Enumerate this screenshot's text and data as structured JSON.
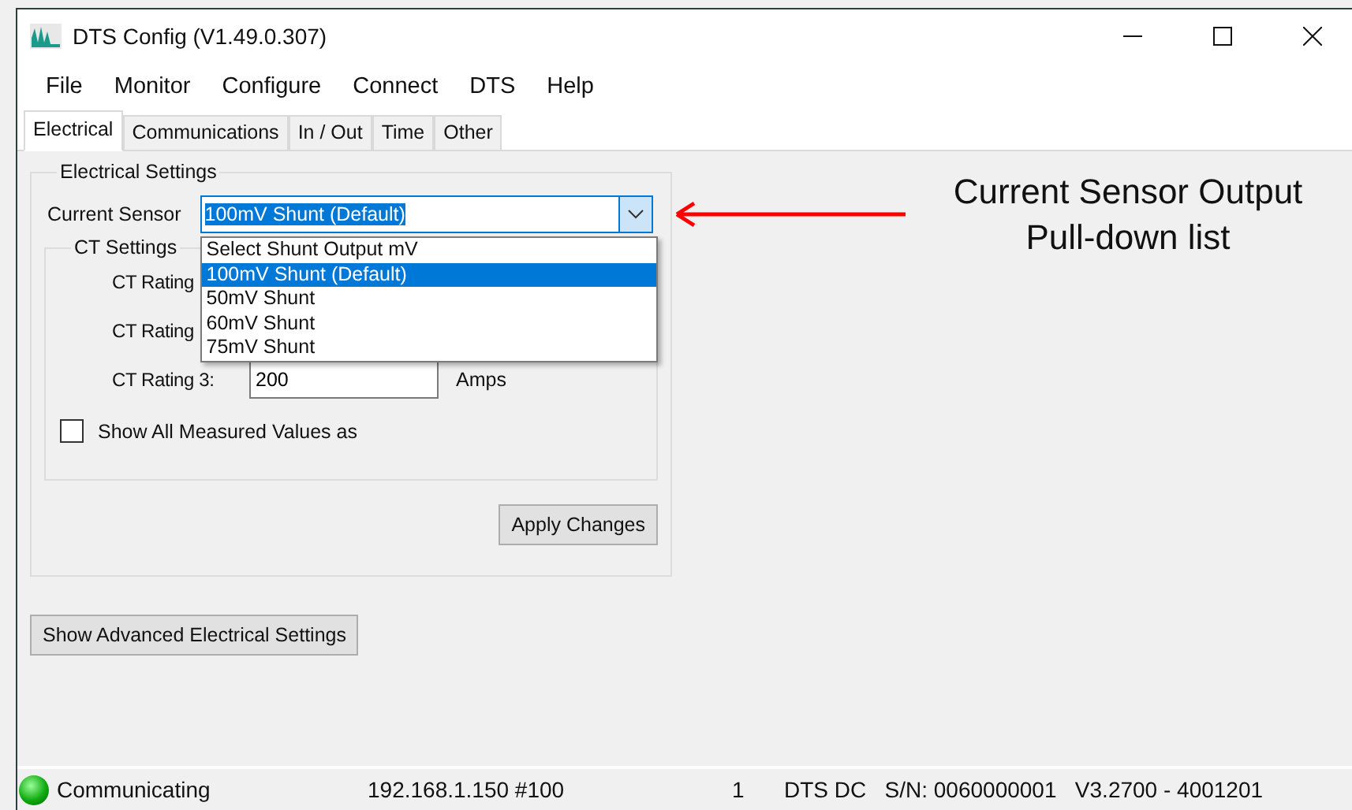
{
  "window": {
    "title": "DTS Config (V1.49.0.307)"
  },
  "menu": [
    "File",
    "Monitor",
    "Configure",
    "Connect",
    "DTS",
    "Help"
  ],
  "tabs": [
    {
      "label": "Electrical",
      "selected": true
    },
    {
      "label": "Communications",
      "selected": false
    },
    {
      "label": "In / Out",
      "selected": false
    },
    {
      "label": "Time",
      "selected": false
    },
    {
      "label": "Other",
      "selected": false
    }
  ],
  "electrical_settings": {
    "title": "Electrical Settings",
    "current_sensor": {
      "label": "Current Sensor",
      "value": "100mV Shunt (Default)",
      "expanded": true,
      "options": [
        {
          "label": "Select Shunt Output mV",
          "selected": false
        },
        {
          "label": "100mV Shunt (Default)",
          "selected": true
        },
        {
          "label": "50mV Shunt",
          "selected": false
        },
        {
          "label": "60mV Shunt",
          "selected": false
        },
        {
          "label": "75mV Shunt",
          "selected": false
        }
      ]
    },
    "ct_settings": {
      "title": "CT Settings",
      "ratings": [
        {
          "label": "CT Rating"
        },
        {
          "label": "CT Rating"
        },
        {
          "label": "CT Rating 3:",
          "value": "200",
          "unit": "Amps"
        }
      ]
    },
    "show_all_measured": {
      "label": "Show All Measured Values as",
      "checked": false
    },
    "apply_button": "Apply Changes"
  },
  "advanced_button": "Show Advanced Electrical Settings",
  "status_bar": {
    "connected": true,
    "status": "Communicating",
    "address": "192.168.1.150 #100",
    "count": "1",
    "device": "DTS DC   S/N: 0060000001   V3.2700 - 4001201"
  },
  "annotation": {
    "lines": [
      "Current Sensor Output",
      "Pull-down list"
    ]
  }
}
